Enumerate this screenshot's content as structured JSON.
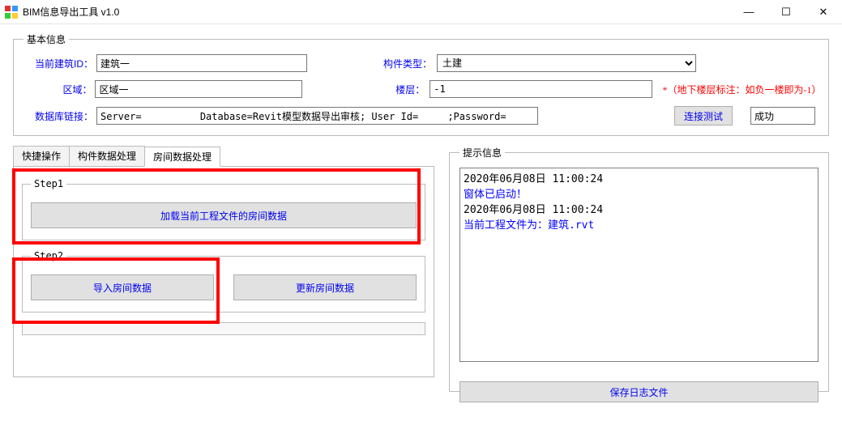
{
  "window": {
    "title": "BIM信息导出工具 v1.0"
  },
  "basic_info": {
    "legend": "基本信息",
    "building_id_label": "当前建筑ID：",
    "building_id_value": "建筑一",
    "component_type_label": "构件类型：",
    "component_type_value": "土建",
    "area_label": "区域：",
    "area_value": "区域一",
    "floor_label": "楼层：",
    "floor_value": "-1",
    "floor_note": "*（地下楼层标注：如负一楼即为-1）",
    "db_label": "数据库链接：",
    "db_value": "Server=          Database=Revit模型数据导出审核; User Id=     ;Password=",
    "btn_test": "连接测试",
    "status": "成功"
  },
  "tabs": {
    "tab_quick": "快捷操作",
    "tab_component": "构件数据处理",
    "tab_room": "房间数据处理",
    "step1_legend": "Step1",
    "step1_btn": "加载当前工程文件的房间数据",
    "step2_legend": "Step2",
    "step2_btn_import": "导入房间数据",
    "step2_btn_update": "更新房间数据"
  },
  "log_section": {
    "legend": "提示信息",
    "lines": [
      {
        "text": "2020年06月08日 11:00:24",
        "cls": ""
      },
      {
        "text": "窗体已启动！",
        "cls": "log-blue"
      },
      {
        "text": "2020年06月08日 11:00:24",
        "cls": ""
      },
      {
        "text": "当前工程文件为：建筑.rvt",
        "cls": "log-blue"
      }
    ],
    "btn_save": "保存日志文件"
  }
}
